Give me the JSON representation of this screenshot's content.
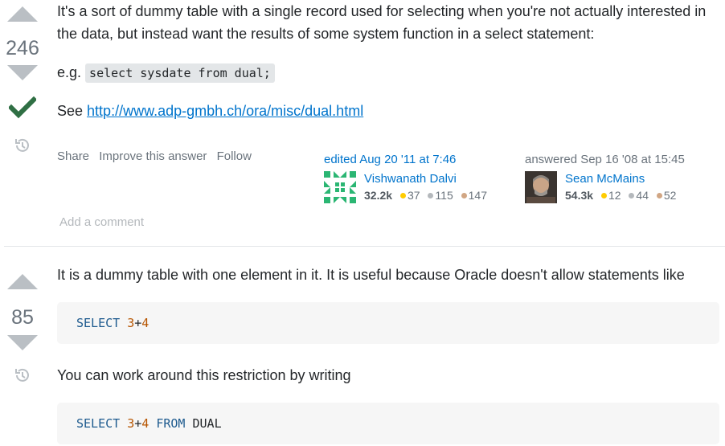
{
  "answers": [
    {
      "score": "246",
      "accepted": true,
      "body": {
        "p1": "It's a sort of dummy table with a single record used for selecting when you're not actually interested in the data, but instead want the results of some system function in a select statement:",
        "eg_prefix": "e.g.",
        "eg_code": "select sysdate from dual;",
        "see_prefix": "See",
        "link": "http://www.adp-gmbh.ch/ora/misc/dual.html"
      },
      "menu": [
        "Share",
        "Improve this answer",
        "Follow"
      ],
      "editor": {
        "action": "edited Aug 20 '11 at 7:46",
        "name": "Vishwanath Dalvi",
        "rep": "32.2k",
        "gold": "37",
        "silver": "115",
        "bronze": "147"
      },
      "author": {
        "action": "answered Sep 16 '08 at 15:45",
        "name": "Sean McMains",
        "rep": "54.3k",
        "gold": "12",
        "silver": "44",
        "bronze": "52"
      },
      "add_comment": "Add a comment"
    },
    {
      "score": "85",
      "body": {
        "p1": "It is a dummy table with one element in it. It is useful because Oracle doesn't allow statements like",
        "code1": {
          "kw1": "SELECT",
          "n1": "3",
          "op": "+",
          "n2": "4"
        },
        "p2": "You can work around this restriction by writing",
        "code2": {
          "kw1": "SELECT",
          "n1": "3",
          "op": "+",
          "n2": "4",
          "kw2": "FROM",
          "tbl": "DUAL"
        }
      }
    }
  ],
  "colors": {
    "accent": "#0074cc",
    "accepted_check": "#2f6f44",
    "vote_arrow": "#babfc4",
    "gold_badge": "#ffcc01",
    "silver_badge": "#b4b8bc",
    "bronze_badge": "#d1a684"
  },
  "icons": [
    "upvote-icon",
    "downvote-icon",
    "accepted-check-icon",
    "history-icon"
  ]
}
